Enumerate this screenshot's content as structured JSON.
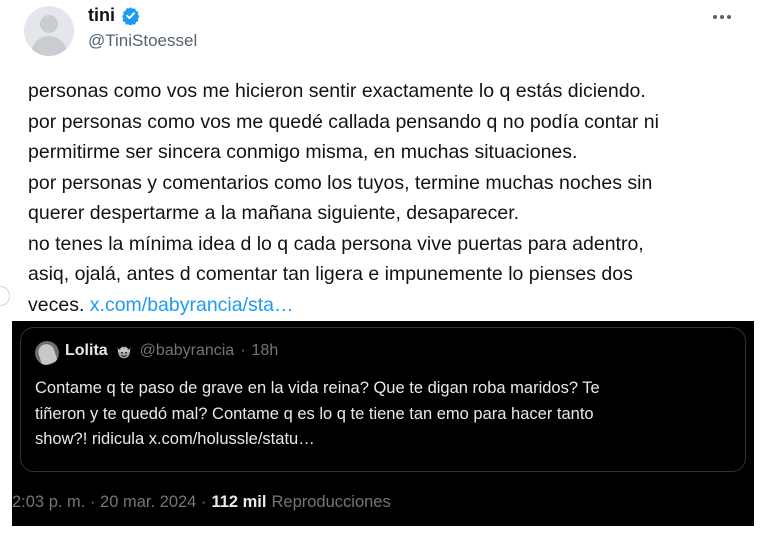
{
  "author": {
    "display_name": "tini",
    "handle": "@TiniStoessel",
    "verified": true,
    "verified_color": "#1d9bf0"
  },
  "tweet": {
    "lines": [
      "personas como vos me hicieron sentir exactamente lo q estás diciendo.",
      "por personas como vos me quedé callada pensando q no podía contar ni",
      "permitirme ser sincera conmigo misma, en muchas situaciones.",
      "por personas y comentarios como los tuyos, termine muchas noches sin",
      "querer despertarme a la mañana siguiente, desaparecer.",
      "no tenes la mínima idea d lo q cada persona vive puertas para adentro,",
      "asiq, ojalá, antes d comentar tan ligera e impunemente lo pienses dos"
    ],
    "last_line_prefix": "veces.",
    "link_text": "x.com/babyrancia/sta…"
  },
  "quote": {
    "display_name": "Lolita",
    "handle": "@babyrancia",
    "separator": "·",
    "time": "18h",
    "lines": [
      "Contame q te paso de grave en la vida reina? Que te digan roba maridos? Te",
      "tiñeron y te quedó mal? Contame q es lo q te tiene tan emo para hacer tanto",
      "show?! ridicula x.com/holussle/statu…"
    ]
  },
  "meta": {
    "timestamp": "2:03 p. m. · 20 mar. 2024 ·",
    "views_count": "112 mil",
    "views_label": "Reproducciones"
  },
  "colors": {
    "link": "#1d9bf0",
    "quote_background": "#000000",
    "secondary_text": "#536471"
  },
  "icons": [
    "verified-badge-icon",
    "more-options-icon",
    "crown-emoji-icon"
  ]
}
